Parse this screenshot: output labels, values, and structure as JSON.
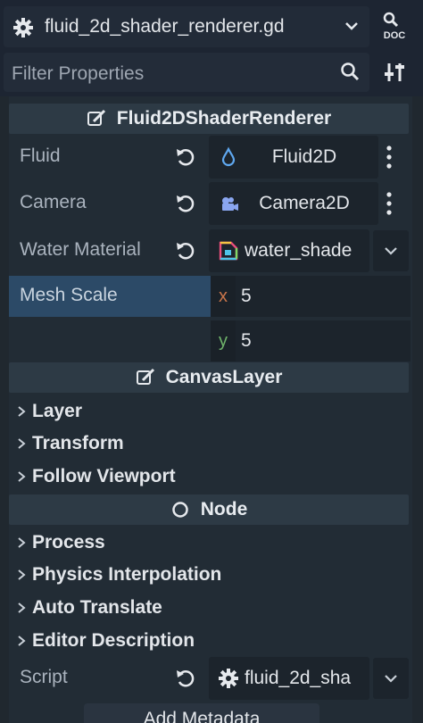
{
  "topbar": {
    "script_name": "fluid_2d_shader_renderer.gd",
    "icons": {
      "gear": "gear-icon",
      "chevron": "chevron-down-icon",
      "doc": "doc-icon"
    }
  },
  "filter": {
    "placeholder": "Filter Properties",
    "icons": {
      "search": "search-icon",
      "tools": "tools-icon"
    }
  },
  "sections": {
    "fluid2d_renderer": "Fluid2DShaderRenderer",
    "canvas_layer": "CanvasLayer",
    "node": "Node"
  },
  "properties": {
    "fluid": {
      "label": "Fluid",
      "value": "Fluid2D"
    },
    "camera": {
      "label": "Camera",
      "value": "Camera2D"
    },
    "water_material": {
      "label": "Water Material",
      "value": "water_shade"
    },
    "mesh_scale": {
      "label": "Mesh Scale",
      "x_axis": "x",
      "x": "5",
      "y_axis": "y",
      "y": "5"
    },
    "script": {
      "label": "Script",
      "value": "fluid_2d_sha"
    }
  },
  "canvas_layer_groups": [
    "Layer",
    "Transform",
    "Follow Viewport"
  ],
  "node_groups": [
    "Process",
    "Physics Interpolation",
    "Auto Translate",
    "Editor Description"
  ],
  "add_metadata": "Add Metadata",
  "colors": {
    "accent_blue": "#5fa8f0",
    "axis_x": "#c9754a",
    "axis_y": "#6fb36a",
    "selected_row": "#2c4a67"
  }
}
